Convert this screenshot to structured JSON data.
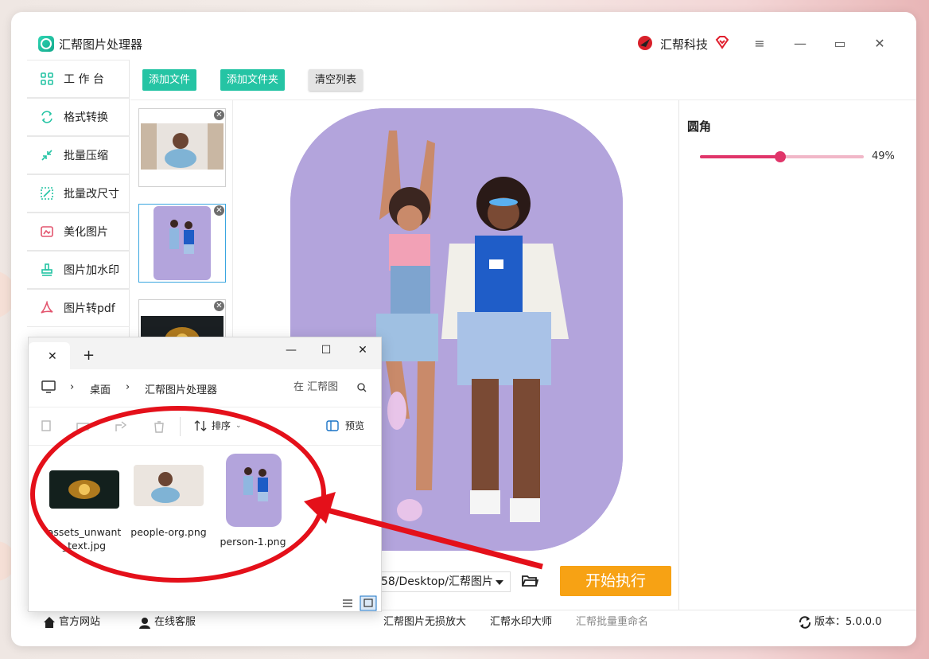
{
  "app": {
    "title": "汇帮图片处理器",
    "brand": "汇帮科技"
  },
  "sidebar": {
    "items": [
      {
        "label": "工 作 台"
      },
      {
        "label": "格式转换"
      },
      {
        "label": "批量压缩"
      },
      {
        "label": "批量改尺寸"
      },
      {
        "label": "美化图片"
      },
      {
        "label": "图片加水印"
      },
      {
        "label": "图片转pdf"
      }
    ]
  },
  "toolbar": {
    "add_file": "添加文件",
    "add_folder": "添加文件夹",
    "clear_list": "清空列表"
  },
  "right_panel": {
    "title": "圆角",
    "slider_value": "49%",
    "slider_fraction": 0.49
  },
  "output": {
    "path": "58/Desktop/汇帮图片",
    "start_label": "开始执行"
  },
  "footer": {
    "website": "官方网站",
    "support": "在线客服",
    "link1": "汇帮图片无损放大",
    "link2": "汇帮水印大师",
    "link3": "汇帮批量重命名",
    "version": "版本：5.0.0.0"
  },
  "explorer": {
    "breadcrumb": [
      "桌面",
      "汇帮图片处理器"
    ],
    "search_placeholder": "在 汇帮图",
    "sort_label": "排序",
    "preview_label": "预览",
    "files": [
      {
        "name": "assets_unwant_text.jpg"
      },
      {
        "name": "people-org.png"
      },
      {
        "name": "person-1.png"
      }
    ]
  },
  "colors": {
    "accent_teal": "#25c4a4",
    "start_orange": "#f7a214",
    "slider_pink": "#e0356a",
    "annotation_red": "#e4101a"
  }
}
